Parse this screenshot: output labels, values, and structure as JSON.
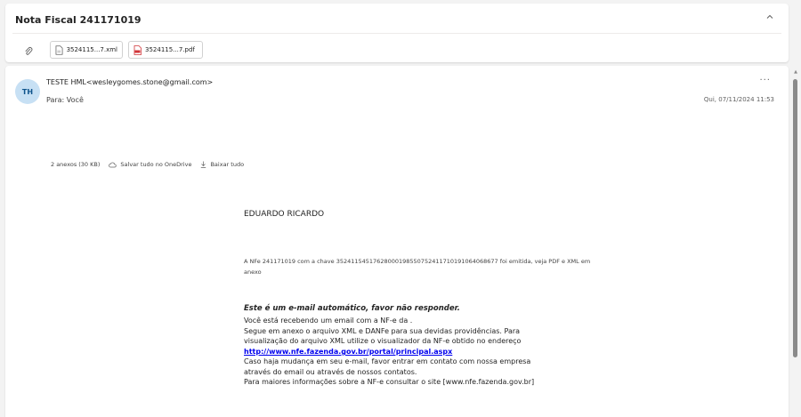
{
  "summary": {
    "subject": "Nota Fiscal 241171019",
    "attachments": [
      {
        "name": "3524115...7.xml",
        "icon": "xml-file-icon"
      },
      {
        "name": "3524115...7.pdf",
        "icon": "pdf-file-icon"
      }
    ]
  },
  "message": {
    "avatar_initials": "TH",
    "sender": "TESTE HML<wesleygomes.stone@gmail.com>",
    "recipient": "Para:  Você",
    "date": "Qui, 07/11/2024 11:53",
    "more": "···",
    "attachments_bar": {
      "count": "2 anexos (30 KB)",
      "save_all": "Salvar tudo no OneDrive",
      "download_all": "Baixar tudo"
    },
    "body": {
      "greeting": "EDUARDO RICARDO",
      "note": "A NFe 241171019 com a chave 35241154517628000198550752411710191064068677 foi emitida, veja PDF e XML em anexo",
      "auto_notice": "Este é um e-mail automático, favor não responder.",
      "line1": "Você está recebendo um email com a NF-e da .",
      "line2": "Segue em anexo o arquivo XML e DANFe para sua devidas providências. Para",
      "line3": "visualização do arquivo XML utilize o visualizador da NF-e obtido no endereço",
      "link": "http://www.nfe.fazenda.gov.br/portal/principal.aspx",
      "line5": "Caso haja mudança em seu e-mail, favor entrar em contato com nossa empresa",
      "line6": "através do email ou através de nossos contatos.",
      "line7": "Para maiores informações sobre a NF-e consultar o site [www.nfe.fazenda.gov.br]"
    }
  },
  "colors": {
    "background": "#f3f3f3",
    "card": "#ffffff",
    "avatar_bg": "#c7e0f4",
    "avatar_text": "#0f548c",
    "link": "#0000ee",
    "pdf_red": "#d13438"
  }
}
